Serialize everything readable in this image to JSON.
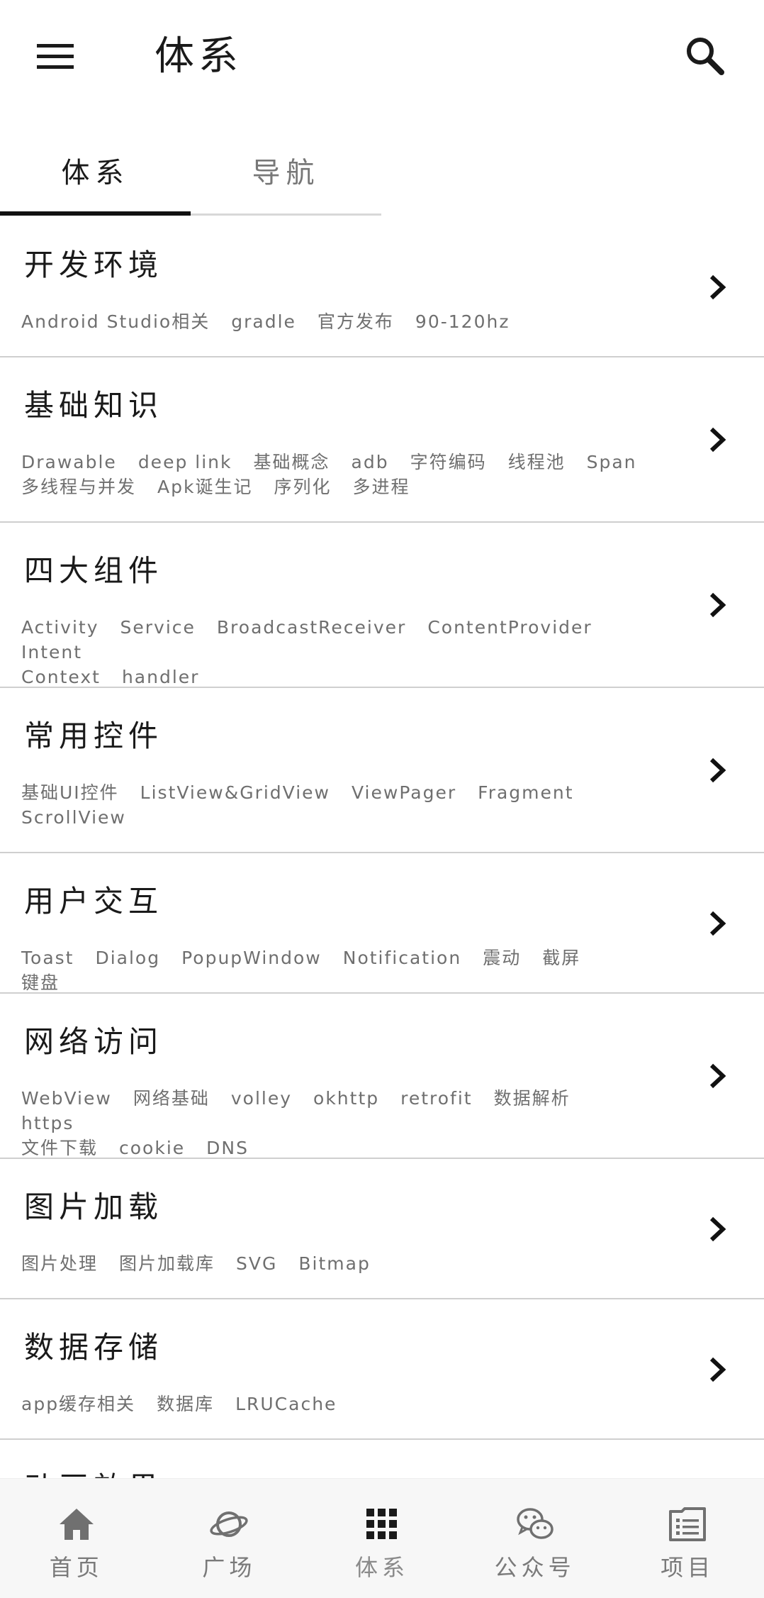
{
  "header": {
    "title": "体系"
  },
  "tabs": [
    {
      "label": "体系"
    },
    {
      "label": "导航"
    }
  ],
  "items": [
    {
      "title": "开发环境",
      "tags": [
        "Android Studio相关",
        "gradle",
        "官方发布",
        "90-120hz"
      ]
    },
    {
      "title": "基础知识",
      "tags": [
        "Drawable",
        "deep link",
        "基础概念",
        "adb",
        "字符编码",
        "线程池",
        "Span",
        "多线程与并发",
        "Apk诞生记",
        "序列化",
        "多进程"
      ]
    },
    {
      "title": "四大组件",
      "tags": [
        "Activity",
        "Service",
        "BroadcastReceiver",
        "ContentProvider",
        "Intent",
        "Context",
        "handler"
      ]
    },
    {
      "title": "常用控件",
      "tags": [
        "基础UI控件",
        "ListView&GridView",
        "ViewPager",
        "Fragment",
        "ScrollView"
      ]
    },
    {
      "title": "用户交互",
      "tags": [
        "Toast",
        "Dialog",
        "PopupWindow",
        "Notification",
        "震动",
        "截屏",
        "键盘"
      ]
    },
    {
      "title": "网络访问",
      "tags": [
        "WebView",
        "网络基础",
        "volley",
        "okhttp",
        "retrofit",
        "数据解析",
        "https",
        "文件下载",
        "cookie",
        "DNS"
      ]
    },
    {
      "title": "图片加载",
      "tags": [
        "图片处理",
        "图片加载库",
        "SVG",
        "Bitmap"
      ]
    },
    {
      "title": "数据存储",
      "tags": [
        "app缓存相关",
        "数据库",
        "LRUCache"
      ]
    },
    {
      "title": "动画效果",
      "tags": []
    }
  ],
  "bottom_nav": [
    {
      "label": "首页",
      "icon": "home-icon"
    },
    {
      "label": "广场",
      "icon": "planet-icon"
    },
    {
      "label": "体系",
      "icon": "grid-icon"
    },
    {
      "label": "公众号",
      "icon": "wechat-icon"
    },
    {
      "label": "项目",
      "icon": "list-icon"
    }
  ],
  "colors": {
    "text": "#1a1a1a",
    "tag_text": "#6f6f6f",
    "divider": "#cfcfcf",
    "bottom_nav_bg": "#f7f7f7",
    "nav_icon": "#707070"
  }
}
